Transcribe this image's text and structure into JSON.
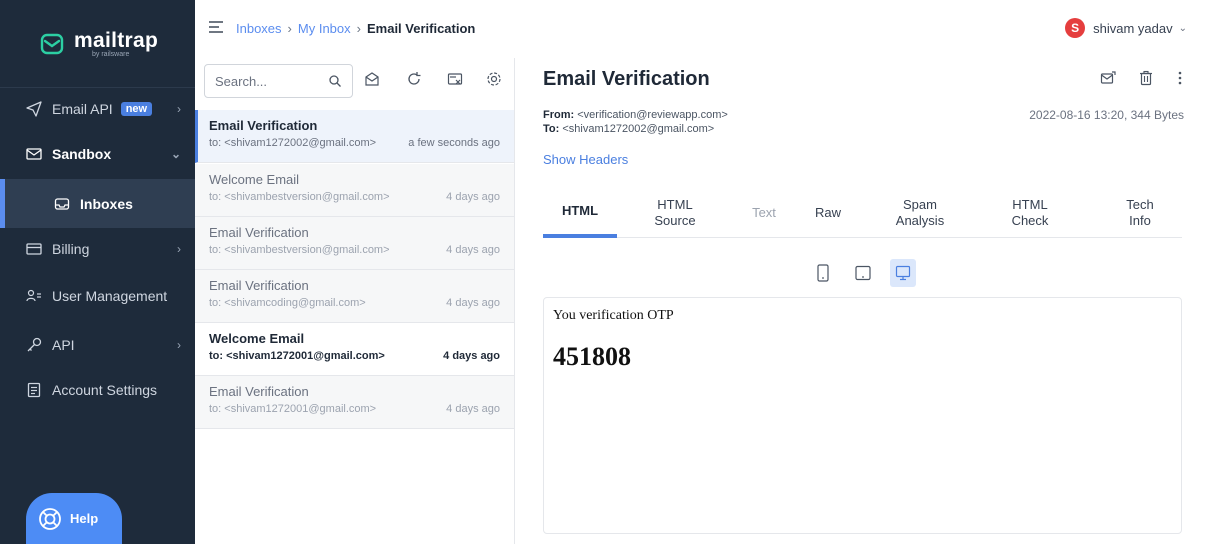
{
  "app": {
    "logo_text": "mailtrap",
    "logo_sub": "by railsware"
  },
  "sidebar": {
    "items": [
      {
        "label": "Email API",
        "badge": "new"
      },
      {
        "label": "Sandbox"
      },
      {
        "label": "Inboxes"
      },
      {
        "label": "Billing"
      },
      {
        "label": "User Management"
      },
      {
        "label": "API"
      },
      {
        "label": "Account Settings"
      }
    ],
    "help_label": "Help"
  },
  "breadcrumb": {
    "items": [
      "Inboxes",
      "My Inbox"
    ],
    "current": "Email Verification"
  },
  "user": {
    "initial": "S",
    "name": "shivam yadav"
  },
  "search": {
    "placeholder": "Search..."
  },
  "messages": [
    {
      "subject": "Email Verification",
      "to": "to: <shivam1272002@gmail.com>",
      "time": "a few seconds ago",
      "state": "selected"
    },
    {
      "subject": "Welcome Email",
      "to": "to: <shivambestversion@gmail.com>",
      "time": "4 days ago",
      "state": "read"
    },
    {
      "subject": "Email Verification",
      "to": "to: <shivambestversion@gmail.com>",
      "time": "4 days ago",
      "state": "read"
    },
    {
      "subject": "Email Verification",
      "to": "to: <shivamcoding@gmail.com>",
      "time": "4 days ago",
      "state": "read"
    },
    {
      "subject": "Welcome Email",
      "to": "to: <shivam1272001@gmail.com>",
      "time": "4 days ago",
      "state": "unread"
    },
    {
      "subject": "Email Verification",
      "to": "to: <shivam1272001@gmail.com>",
      "time": "4 days ago",
      "state": "read"
    }
  ],
  "message": {
    "title": "Email Verification",
    "from_label": "From:",
    "from": "<verification@reviewapp.com>",
    "to_label": "To:",
    "to": "<shivam1272002@gmail.com>",
    "date_size": "2022-08-16 13:20, 344 Bytes",
    "show_headers": "Show Headers",
    "tabs": [
      {
        "label": "HTML"
      },
      {
        "label": "HTML Source"
      },
      {
        "label": "Text"
      },
      {
        "label": "Raw"
      },
      {
        "label": "Spam Analysis"
      },
      {
        "label": "HTML Check"
      },
      {
        "label": "Tech Info"
      }
    ],
    "body_text": "You verification OTP",
    "otp": "451808"
  },
  "colors": {
    "sidebar_bg": "#1e2b3b",
    "accent": "#4a7fe0",
    "avatar": "#e53e3e"
  }
}
